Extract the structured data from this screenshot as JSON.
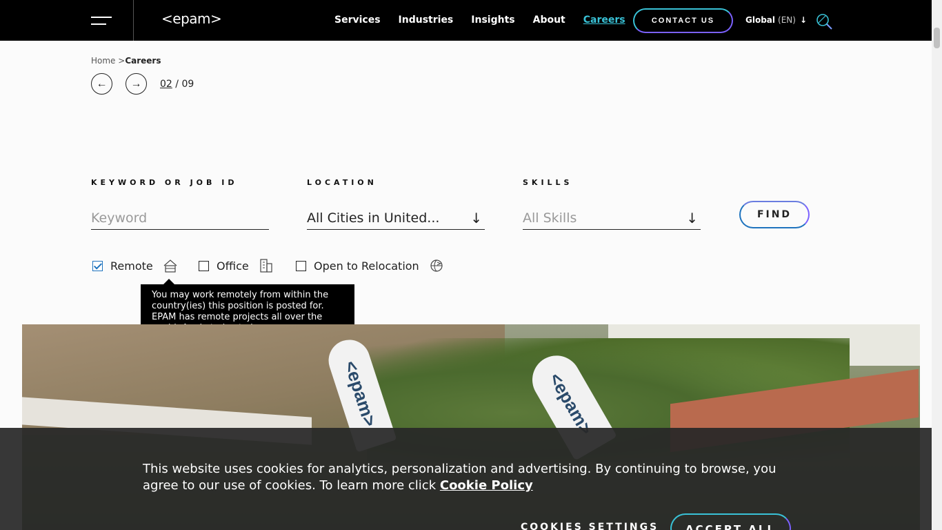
{
  "header": {
    "logo": "<epam>",
    "nav": [
      {
        "label": "Services",
        "active": false
      },
      {
        "label": "Industries",
        "active": false
      },
      {
        "label": "Insights",
        "active": false
      },
      {
        "label": "About",
        "active": false
      },
      {
        "label": "Careers",
        "active": true
      }
    ],
    "contact_label": "CONTACT US",
    "lang_label": "Global",
    "lang_code": "(EN)",
    "accent_color": "#39c2d7"
  },
  "breadcrumb": {
    "home": "Home",
    "separator": ">",
    "current": "Careers"
  },
  "pager": {
    "current": "02",
    "separator": "/",
    "total": "09"
  },
  "search": {
    "keyword_label": "KEYWORD OR JOB ID",
    "keyword_placeholder": "Keyword",
    "location_label": "LOCATION",
    "location_value": "All Cities in United...",
    "skills_label": "SKILLS",
    "skills_value": "All Skills",
    "find_label": "FIND"
  },
  "filters": [
    {
      "label": "Remote",
      "checked": true,
      "icon": "home-icon"
    },
    {
      "label": "Office",
      "checked": false,
      "icon": "building-icon"
    },
    {
      "label": "Open to Relocation",
      "checked": false,
      "icon": "globe-plane-icon"
    }
  ],
  "tooltip": {
    "text": "You may work remotely from within the country(ies) this position is posted for. EPAM has remote projects all over the world. Apply today to learn more."
  },
  "cookie": {
    "text": "This website uses cookies for analytics, personalization and advertising. By continuing to browse, you agree to our use of cookies. To learn more click",
    "policy_link": "Cookie Policy",
    "settings_label": "COOKIES SETTINGS",
    "accept_label": "ACCEPT ALL"
  }
}
